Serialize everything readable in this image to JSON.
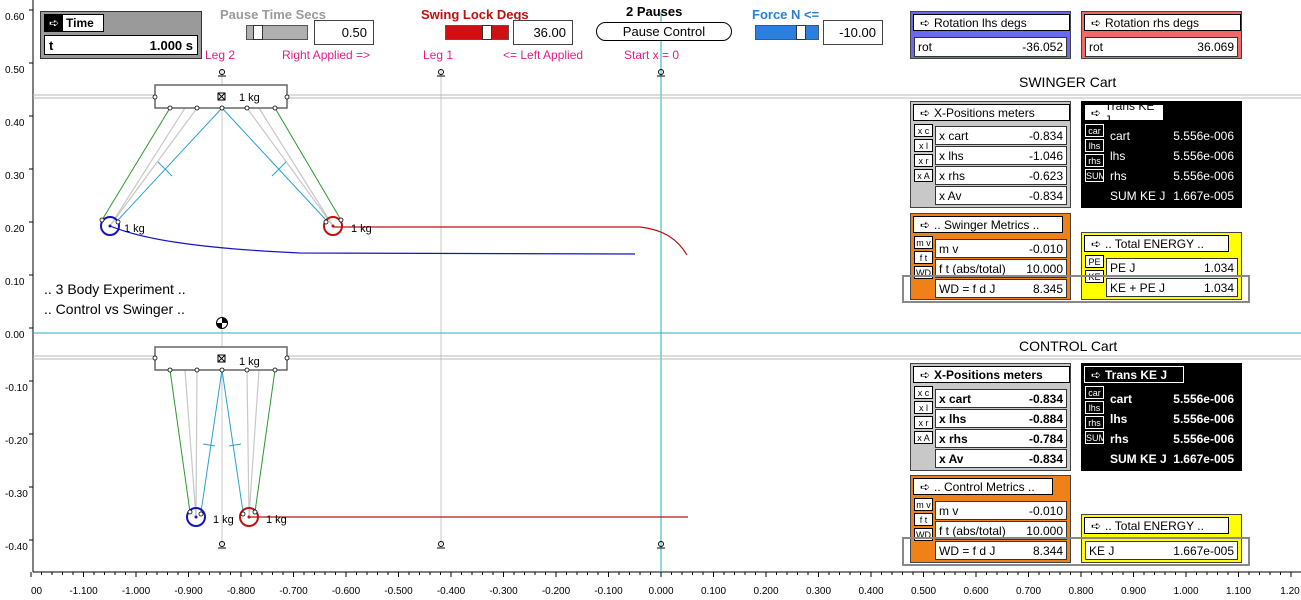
{
  "colors": {
    "swinger_blue": "#1515c0",
    "swinger_red": "#c01010",
    "leg_green": "#2a9a2a",
    "leg_cyan": "#2aa0d0",
    "panel_blue": "#6a6af0",
    "panel_red": "#f06868",
    "panel_gray": "#c8c8c8",
    "panel_orange": "#f08018",
    "panel_yellow": "#ffff00",
    "axis_cyan": "#20b0c0",
    "label_pink": "#e0208a"
  },
  "time": {
    "title": "Time",
    "label": "t",
    "value": "1.000 s"
  },
  "pause": {
    "title": "Pause Time Secs",
    "value": "0.50"
  },
  "swing": {
    "title": "Swing Lock Degs",
    "value": "36.00"
  },
  "pauses": {
    "title": "2 Pauses",
    "button": "Pause Control"
  },
  "force": {
    "title": "Force N <=",
    "value": "-10.00"
  },
  "rot_lhs": {
    "title": "Rotation lhs degs",
    "label": "rot",
    "value": "-36.052"
  },
  "rot_rhs": {
    "title": "Rotation rhs degs",
    "label": "rot",
    "value": "36.069"
  },
  "annot": {
    "leg2": "Leg 2",
    "right_applied": "Right Applied =>",
    "leg1": "Leg 1",
    "left_applied": "<= Left Applied",
    "start": "Start x = 0"
  },
  "swinger": {
    "title": "SWINGER Cart",
    "mass": "1 kg",
    "xpos": {
      "title": "X-Positions meters",
      "side": [
        "x c",
        "x l",
        "x r",
        "x A"
      ],
      "rows": [
        {
          "label": "x cart",
          "value": "-0.834"
        },
        {
          "label": "x lhs",
          "value": "-1.046"
        },
        {
          "label": "x rhs",
          "value": "-0.623"
        },
        {
          "label": "x Av",
          "value": "-0.834"
        }
      ]
    },
    "ke": {
      "title": "Trans KE J",
      "side": [
        "car",
        "lhs",
        "rhs",
        "SUM"
      ],
      "rows": [
        {
          "label": "cart",
          "value": "5.556e-006"
        },
        {
          "label": "lhs",
          "value": "5.556e-006"
        },
        {
          "label": "rhs",
          "value": "5.556e-006"
        },
        {
          "label": "SUM KE J",
          "value": "1.667e-005"
        }
      ]
    },
    "metrics": {
      "title": ".. Swinger Metrics ..",
      "side": [
        "m v",
        "f t",
        "WD"
      ],
      "rows": [
        {
          "label": "m v",
          "value": "-0.010"
        },
        {
          "label": "f t (abs/total)",
          "value": "10.000"
        },
        {
          "label": "WD = f d J",
          "value": "8.345"
        }
      ]
    },
    "energy": {
      "title": ".. Total ENERGY ..",
      "side": [
        "PE",
        "KE"
      ],
      "rows": [
        {
          "label": "PE J",
          "value": "1.034"
        },
        {
          "label": "KE + PE J",
          "value": "1.034"
        }
      ]
    }
  },
  "control": {
    "title": "CONTROL Cart",
    "mass": "1 kg",
    "xpos": {
      "title": "X-Positions meters",
      "side": [
        "x c",
        "x l",
        "x r",
        "x A"
      ],
      "rows": [
        {
          "label": "x cart",
          "value": "-0.834"
        },
        {
          "label": "x lhs",
          "value": "-0.884"
        },
        {
          "label": "x rhs",
          "value": "-0.784"
        },
        {
          "label": "x Av",
          "value": "-0.834"
        }
      ]
    },
    "ke": {
      "title": "Trans KE J",
      "side": [
        "car",
        "lhs",
        "rhs",
        "SUM"
      ],
      "rows": [
        {
          "label": "cart",
          "value": "5.556e-006"
        },
        {
          "label": "lhs",
          "value": "5.556e-006"
        },
        {
          "label": "rhs",
          "value": "5.556e-006"
        },
        {
          "label": "SUM KE J",
          "value": "1.667e-005"
        }
      ]
    },
    "metrics": {
      "title": ".. Control Metrics ..",
      "side": [
        "m v",
        "f t",
        "WD"
      ],
      "rows": [
        {
          "label": "m v",
          "value": "-0.010"
        },
        {
          "label": "f t (abs/total)",
          "value": "10.000"
        },
        {
          "label": "WD = f d J",
          "value": "8.344"
        }
      ]
    },
    "energy": {
      "title": ".. Total ENERGY ..",
      "rows": [
        {
          "label": "KE  J",
          "value": "1.667e-005"
        }
      ]
    }
  },
  "experiment": {
    "line1": ".. 3 Body Experiment ..",
    "line2": ".. Control vs Swinger .."
  },
  "axis_x_ticks": [
    "00",
    "-1.100",
    "-1.000",
    "-0.900",
    "-0.800",
    "-0.700",
    "-0.600",
    "-0.500",
    "-0.400",
    "-0.300",
    "-0.200",
    "-0.100",
    "0.000",
    "0.100",
    "0.200",
    "0.300",
    "0.400",
    "0.500",
    "0.600",
    "0.700",
    "0.800",
    "0.900",
    "1.000",
    "1.100",
    "1.20"
  ],
  "axis_y_ticks": [
    "0.60",
    "0.50",
    "0.40",
    "0.30",
    "0.20",
    "0.10",
    "0.00",
    "-0.10",
    "-0.20",
    "-0.30",
    "-0.40"
  ]
}
